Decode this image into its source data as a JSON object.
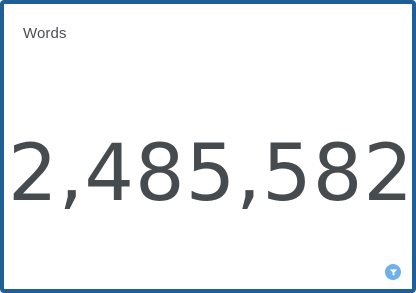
{
  "widget": {
    "title": "Words",
    "value": "2,485,582"
  },
  "colors": {
    "frame": "#1f5f99",
    "text": "#464b50",
    "filter_button": "#6fb0e8"
  },
  "icons": {
    "filter": "filter-icon"
  }
}
